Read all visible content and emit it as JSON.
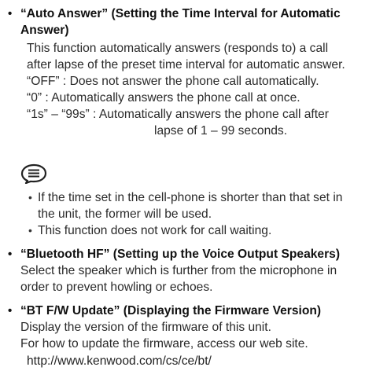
{
  "colors": {
    "text": "#2a2a2a",
    "heading": "#111111"
  },
  "note_icon": "note-speech-bubble-icon",
  "auto_answer": {
    "bullet": "•",
    "heading_line1": "“Auto Answer” (Setting the Time Interval for Automatic",
    "heading_line2": "Answer)",
    "body1": "This function automatically answers (responds to) a call",
    "body2": "after lapse of the preset time interval for automatic answer.",
    "off": "“OFF” : Does not answer the phone call automatically.",
    "zero": "“0” : Automatically answers the phone call at once.",
    "range1": "“1s” – “99s” : Automatically answers the phone call after",
    "range2": "lapse of 1 – 99 seconds."
  },
  "notes": {
    "bullet": "•",
    "note1_line1": "If the time set in the cell-phone is shorter than that set in",
    "note1_line2": "the unit, the former will be used.",
    "note2": "This function does not work for call waiting."
  },
  "bluetooth_hf": {
    "bullet": "•",
    "heading": "“Bluetooth HF” (Setting up the Voice Output Speakers)",
    "body1": "Select the speaker which is further from the microphone in",
    "body2": "order to prevent howling or echoes."
  },
  "bt_fw_update": {
    "bullet": "•",
    "heading": "“BT F/W Update” (Displaying the Firmware Version)",
    "body1": "Display the version of the firmware of this unit.",
    "body2": "For how to update the firmware, access our web site.",
    "url": "http://www.kenwood.com/cs/ce/bt/"
  }
}
